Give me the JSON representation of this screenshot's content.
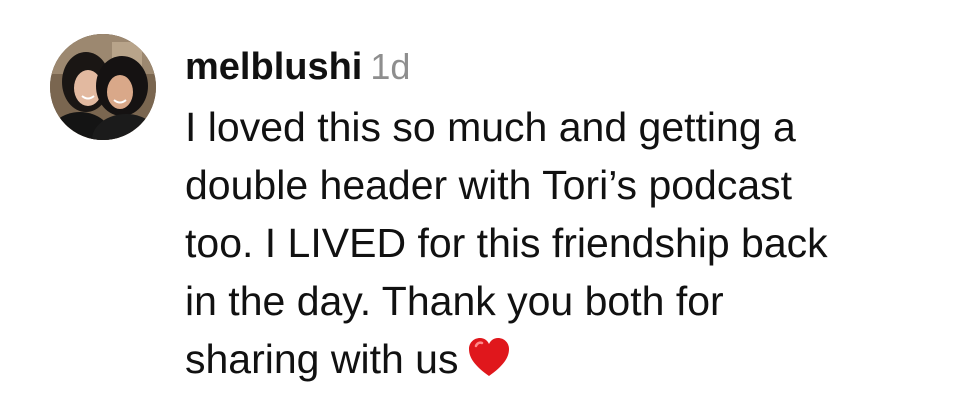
{
  "comment": {
    "avatar_icon": "profile-photo-avatar",
    "username": "melblushi",
    "timestamp": "1d",
    "lines": [
      "I loved this so much and getting a",
      "double header with Tori’s podcast",
      "too. I LIVED for this friendship back",
      "in the day. Thank you both for",
      "sharing with us"
    ],
    "emoji": "❤️",
    "emoji_icon": "red-heart-icon",
    "colors": {
      "text": "#111111",
      "timestamp": "#8e8e8e",
      "heart": "#e0171c"
    }
  }
}
